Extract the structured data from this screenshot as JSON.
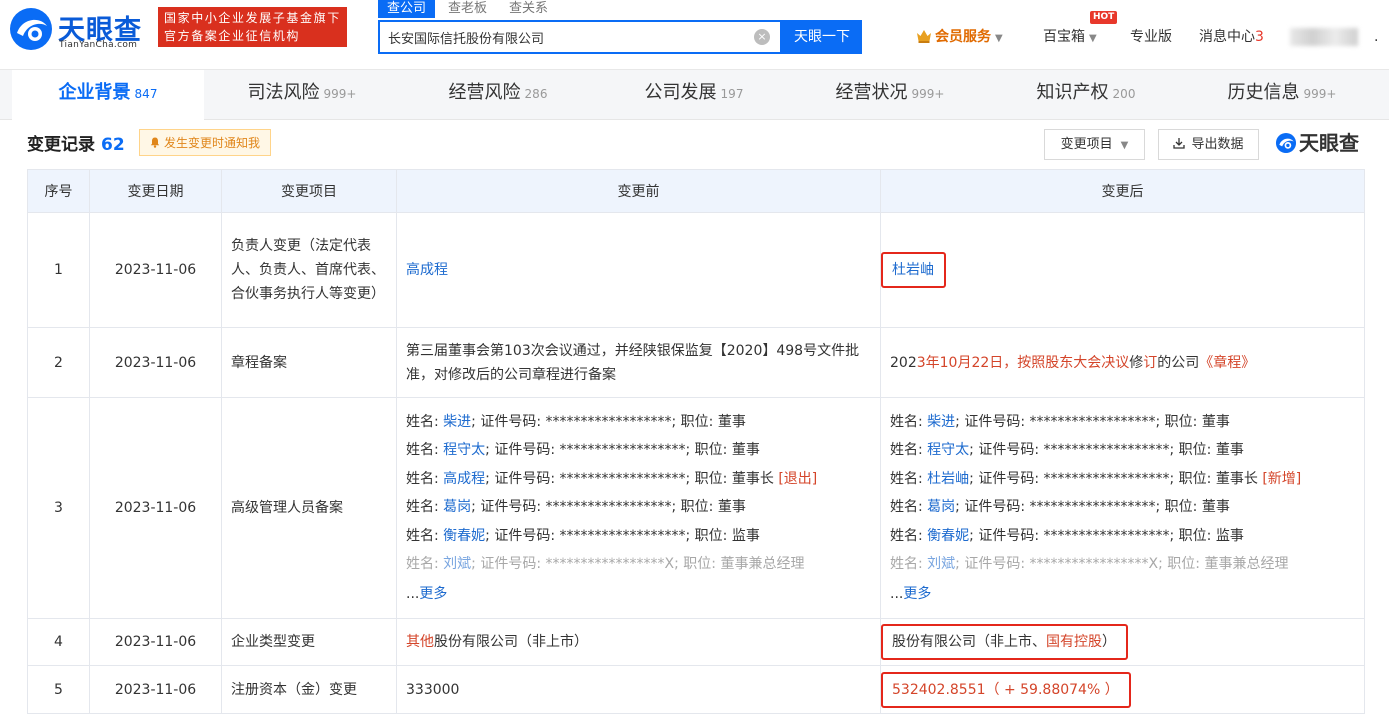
{
  "header": {
    "logo_text": "天眼查",
    "logo_sub": "TianYanCha.com",
    "gov_badge_line1": "国家中小企业发展子基金旗下",
    "gov_badge_line2": "官方备案企业征信机构",
    "search_tabs": [
      "查公司",
      "查老板",
      "查关系"
    ],
    "search_value": "长安国际信托股份有限公司",
    "search_button": "天眼一下",
    "vip_label": "会员服务",
    "treasure_label": "百宝箱",
    "hot_badge": "HOT",
    "pro_label": "专业版",
    "msg_label": "消息中心",
    "msg_count": "3",
    "more_dot": "."
  },
  "main_tabs": [
    {
      "label": "企业背景",
      "count": "847"
    },
    {
      "label": "司法风险",
      "count": "999+"
    },
    {
      "label": "经营风险",
      "count": "286"
    },
    {
      "label": "公司发展",
      "count": "197"
    },
    {
      "label": "经营状况",
      "count": "999+"
    },
    {
      "label": "知识产权",
      "count": "200"
    },
    {
      "label": "历史信息",
      "count": "999+"
    }
  ],
  "section": {
    "title": "变更记录",
    "count": "62",
    "notify_label": "发生变更时通知我",
    "filter_label": "变更项目",
    "export_label": "导出数据",
    "watermark": "天眼查"
  },
  "table": {
    "headers": [
      "序号",
      "变更日期",
      "变更项目",
      "变更前",
      "变更后"
    ],
    "rows": [
      {
        "no": "1",
        "date": "2023-11-06",
        "item": "负责人变更（法定代表人、负责人、首席代表、合伙事务执行人等变更）",
        "before": "高成程",
        "after": "杜岩岫"
      },
      {
        "no": "2",
        "date": "2023-11-06",
        "item": "章程备案",
        "before": "第三届董事会第103次会议通过，并经陕银保监复【2020】498号文件批准，对修改后的公司章程进行备案",
        "after": {
          "p1": "202",
          "p2": "3年10月22日，按照股东大会决议",
          "p3": "修",
          "p4": "订",
          "p5": "的公司",
          "p6": "《章程》"
        }
      },
      {
        "no": "3",
        "date": "2023-11-06",
        "item": "高级管理人员备案",
        "labels": {
          "name": "姓名: ",
          "id": "; 证件号码: ",
          "pos": "; 职位: ",
          "id_masked": "******************",
          "id_masked_x": "*****************X"
        },
        "before_list": [
          {
            "name": "柴进",
            "pos": "董事",
            "tag": ""
          },
          {
            "name": "程守太",
            "pos": "董事",
            "tag": ""
          },
          {
            "name": "高成程",
            "pos": "董事长",
            "tag": "[退出]"
          },
          {
            "name": "葛岗",
            "pos": "董事",
            "tag": ""
          },
          {
            "name": "衡春妮",
            "pos": "监事",
            "tag": ""
          },
          {
            "name": "刘斌",
            "pos": "董事兼总经理",
            "tag": ""
          }
        ],
        "after_list": [
          {
            "name": "柴进",
            "pos": "董事",
            "tag": ""
          },
          {
            "name": "程守太",
            "pos": "董事",
            "tag": ""
          },
          {
            "name": "杜岩岫",
            "pos": "董事长",
            "tag": "[新增]"
          },
          {
            "name": "葛岗",
            "pos": "董事",
            "tag": ""
          },
          {
            "name": "衡春妮",
            "pos": "监事",
            "tag": ""
          },
          {
            "name": "刘斌",
            "pos": "董事兼总经理",
            "tag": ""
          }
        ],
        "more_prefix": "...",
        "more_label": "更多"
      },
      {
        "no": "4",
        "date": "2023-11-06",
        "item": "企业类型变更",
        "before_red": "其他",
        "before_rest": "股份有限公司（非上市）",
        "after_main": "股份有限公司（非上市、",
        "after_red": "国有控股",
        "after_end": "）"
      },
      {
        "no": "5",
        "date": "2023-11-06",
        "item": "注册资本（金）变更",
        "before": "333000",
        "after": "532402.8551（ + 59.88074% ）"
      }
    ]
  },
  "colors": {
    "brand_blue": "#0a6cf5",
    "gov_red": "#d9301e",
    "highlight_red": "#e4271b",
    "link_blue": "#1e6bcf",
    "change_red": "#d4452a"
  }
}
